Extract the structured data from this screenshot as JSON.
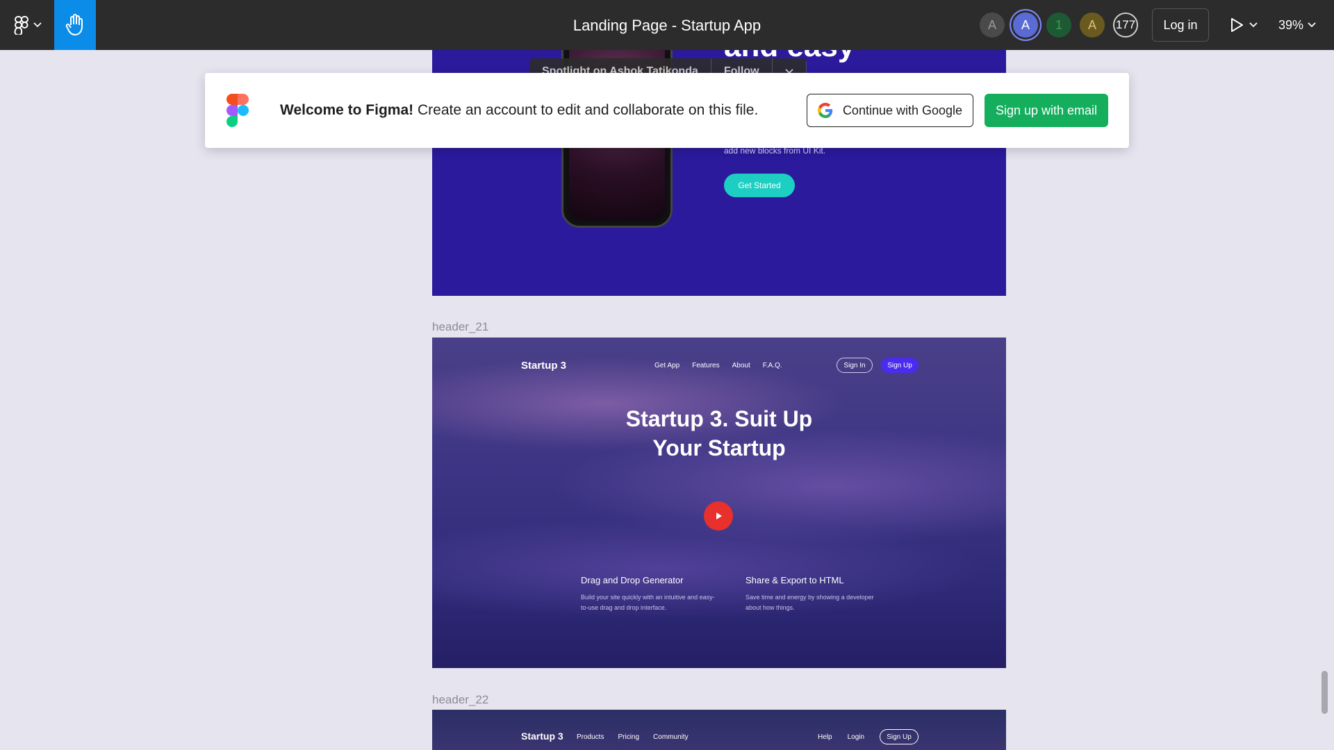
{
  "toolbar": {
    "file_title": "Landing Page - Startup App",
    "avatars": [
      "A",
      "A",
      "1",
      "A"
    ],
    "viewer_count": "177",
    "login_label": "Log in",
    "zoom_level": "39%"
  },
  "banner": {
    "welcome_bold": "Welcome to Figma!",
    "welcome_text": "Create an account to edit and collaborate on this file.",
    "google_label": "Continue with Google",
    "email_label": "Sign up with email"
  },
  "spotlight": {
    "text": "Spotlight on Ashok Tatikonda",
    "follow_label": "Follow"
  },
  "canvas": {
    "top_frame": {
      "heading_peek": "and easy",
      "subtext": "add new blocks from UI Kit.",
      "cta_label": "Get Started"
    },
    "header_21": {
      "label": "header_21",
      "logo": "Startup 3",
      "nav": [
        "Get App",
        "Features",
        "About",
        "F.A.Q."
      ],
      "sign_in": "Sign In",
      "sign_up": "Sign Up",
      "hero_line1": "Startup 3.  Suit Up",
      "hero_line2": "Your Startup",
      "features": [
        {
          "title": "Drag and Drop Generator",
          "text": "Build your site quickly with an intuitive and easy-to-use drag and drop interface."
        },
        {
          "title": "Share & Export to HTML",
          "text": "Save time and energy by showing a developer about how things."
        }
      ]
    },
    "header_22": {
      "label": "header_22",
      "logo": "Startup 3",
      "nav": [
        "Products",
        "Pricing",
        "Community"
      ],
      "right_links": [
        "Help",
        "Login"
      ],
      "sign_up": "Sign Up"
    }
  },
  "colors": {
    "toolbar_bg": "#2c2c2c",
    "hand_tool_active": "#0c8ce9",
    "signup_green": "#14ae5c",
    "canvas_bg": "#e6e4ef"
  }
}
